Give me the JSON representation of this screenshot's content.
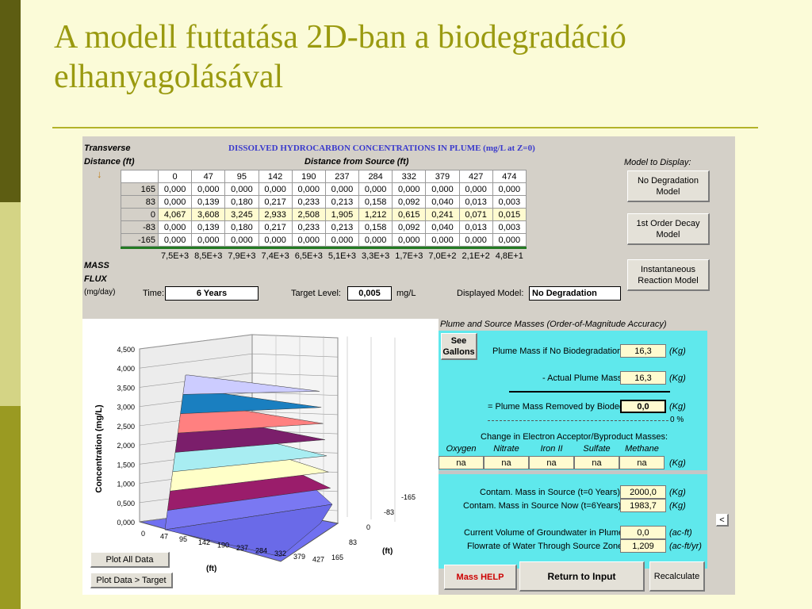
{
  "slide": {
    "title_line1": "A modell futtatása 2D-ban a biodegradáció",
    "title_line2": "elhanyagolásával"
  },
  "colors": {
    "title": "#9a9a10",
    "panel_cyan": "#5fe8ec",
    "mass_help_red": "#cc0000"
  },
  "app": {
    "transverse_label": "Transverse",
    "distance_label": "Distance (ft)",
    "table_title": "DISSOLVED HYDROCARBON CONCENTRATIONS IN PLUME (mg/L at Z=0)",
    "distance_from_source_label": "Distance from Source (ft)",
    "arrow_icon": "down-arrow-icon",
    "arrow_glyph": "↓",
    "x_headers": [
      "0",
      "47",
      "95",
      "142",
      "190",
      "237",
      "284",
      "332",
      "379",
      "427",
      "474"
    ],
    "rows": [
      {
        "y": "165",
        "values": [
          "0,000",
          "0,000",
          "0,000",
          "0,000",
          "0,000",
          "0,000",
          "0,000",
          "0,000",
          "0,000",
          "0,000",
          "0,000"
        ]
      },
      {
        "y": "83",
        "values": [
          "0,000",
          "0,139",
          "0,180",
          "0,217",
          "0,233",
          "0,213",
          "0,158",
          "0,092",
          "0,040",
          "0,013",
          "0,003"
        ]
      },
      {
        "y": "0",
        "values": [
          "4,067",
          "3,608",
          "3,245",
          "2,933",
          "2,508",
          "1,905",
          "1,212",
          "0,615",
          "0,241",
          "0,071",
          "0,015"
        ]
      },
      {
        "y": "-83",
        "values": [
          "0,000",
          "0,139",
          "0,180",
          "0,217",
          "0,233",
          "0,213",
          "0,158",
          "0,092",
          "0,040",
          "0,013",
          "0,003"
        ]
      },
      {
        "y": "-165",
        "values": [
          "0,000",
          "0,000",
          "0,000",
          "0,000",
          "0,000",
          "0,000",
          "0,000",
          "0,000",
          "0,000",
          "0,000",
          "0,000"
        ]
      }
    ],
    "mass_flux_label_1": "MASS",
    "mass_flux_label_2": "FLUX",
    "mass_flux_unit": "(mg/day)",
    "mass_flux_values": [
      "7,5E+3",
      "8,5E+3",
      "7,9E+3",
      "7,4E+3",
      "6,5E+3",
      "5,1E+3",
      "3,3E+3",
      "1,7E+3",
      "7,0E+2",
      "2,1E+2",
      "4,8E+1"
    ],
    "time_label": "Time:",
    "time_value": "6 Years",
    "target_level_label": "Target Level:",
    "target_level_value": "0,005",
    "target_unit": "mg/L",
    "displayed_model_label": "Displayed Model:",
    "displayed_model_value": "No Degradation",
    "model_to_display_label": "Model to Display:",
    "buttons": {
      "no_degradation": "No Degradation Model",
      "first_order": "1st Order Decay Model",
      "instantaneous": "Instantaneous Reaction Model",
      "plot_all": "Plot All Data",
      "plot_target": "Plot Data > Target",
      "see_gallons": "See Gallons",
      "mass_help": "Mass HELP",
      "return_to_input": "Return to Input",
      "recalculate": "Recalculate",
      "scroll_left": "<"
    }
  },
  "panel": {
    "title": "Plume and Source Masses (Order-of-Magnitude Accuracy)",
    "plume_mass_no_bio_label": "Plume Mass if No Biodegradation",
    "plume_mass_no_bio_value": "16,3",
    "actual_plume_mass_label": "- Actual Plume Mass",
    "actual_plume_mass_value": "16,3",
    "removed_label": "= Plume Mass Removed by Biodeg",
    "removed_value": "0,0",
    "removed_percent": "0 %",
    "kg_unit": "(Kg)",
    "change_label": "Change in Electron Acceptor/Byproduct Masses:",
    "acceptors": [
      "Oxygen",
      "Nitrate",
      "Iron II",
      "Sulfate",
      "Methane"
    ],
    "acceptor_values": [
      "na",
      "na",
      "na",
      "na",
      "na"
    ],
    "source_t0_label": "Contam. Mass in Source (t=0 Years)",
    "source_t0_value": "2000,0",
    "source_now_label": "Contam. Mass in Source Now (t=6Years)",
    "source_now_value": "1983,7",
    "gw_volume_label": "Current Volume of Groundwater in Plume",
    "gw_volume_value": "0,0",
    "gw_volume_unit": "(ac-ft)",
    "flowrate_label": "Flowrate of Water Through Source Zone",
    "flowrate_value": "1,209",
    "flowrate_unit": "(ac-ft/yr)"
  },
  "chart_data": {
    "type": "surface",
    "ylabel": "Concentration (mg/L)",
    "xlabel": "(ft)",
    "zlabel": "(ft)",
    "y_ticks": [
      "0,000",
      "0,500",
      "1,000",
      "1,500",
      "2,000",
      "2,500",
      "3,000",
      "3,500",
      "4,000",
      "4,500"
    ],
    "x_ticks": [
      "0",
      "47",
      "95",
      "142",
      "190",
      "237",
      "284",
      "332",
      "379",
      "427"
    ],
    "z_ticks": [
      "-165",
      "-83",
      "0",
      "83",
      "165"
    ],
    "ylim": [
      0,
      4.5
    ],
    "band_colors": [
      "#7a78f2",
      "#9a1d6b",
      "#ffffc8",
      "#a8edf2",
      "#7b1e6b",
      "#ff8080",
      "#1a7fc0",
      "#ccccff"
    ],
    "centerline_x": [
      0,
      47,
      95,
      142,
      190,
      237,
      284,
      332,
      379,
      427,
      474
    ],
    "centerline_values": [
      4.067,
      3.608,
      3.245,
      2.933,
      2.508,
      1.905,
      1.212,
      0.615,
      0.241,
      0.071,
      0.015
    ]
  }
}
